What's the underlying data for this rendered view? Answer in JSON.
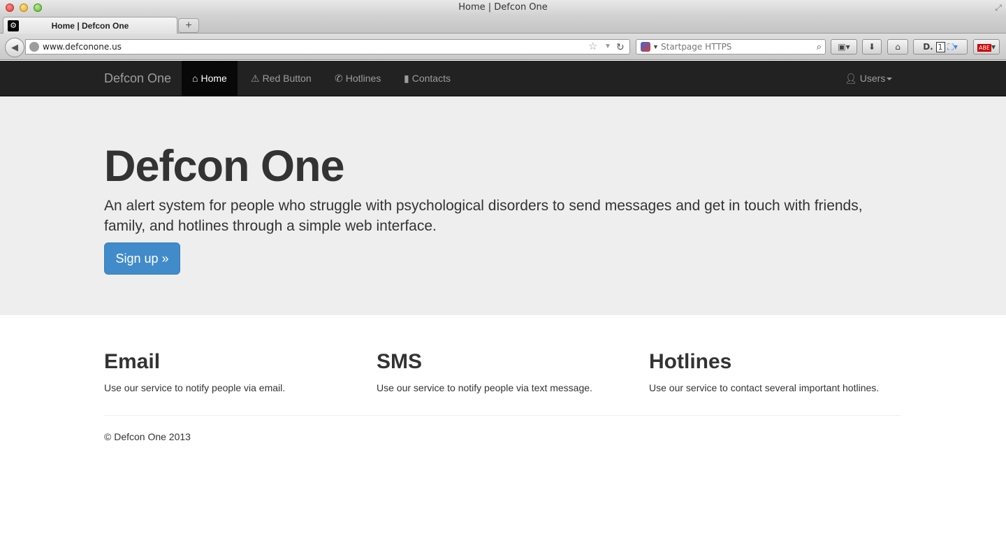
{
  "window": {
    "title": "Home | Defcon One"
  },
  "tabs": [
    {
      "label": "Home | Defcon One",
      "favicon": "gear-icon"
    }
  ],
  "toolbar": {
    "url": "www.defconone.us",
    "search_placeholder": "Startpage HTTPS",
    "icons": [
      "back-arrow-icon",
      "globe-icon",
      "bookmark-star-icon",
      "reload-icon",
      "search-icon",
      "bookmarks-icon",
      "download-icon",
      "home-icon",
      "addon-d-icon",
      "addon-counter-icon",
      "addon-abe-icon"
    ],
    "addon_counter": "1"
  },
  "site_nav": {
    "brand": "Defcon One",
    "items": [
      {
        "label": "Home",
        "icon": "home-icon",
        "active": true
      },
      {
        "label": "Red Button",
        "icon": "warning-icon",
        "active": false
      },
      {
        "label": "Hotlines",
        "icon": "phone-icon",
        "active": false
      },
      {
        "label": "Contacts",
        "icon": "book-icon",
        "active": false
      }
    ],
    "users": {
      "label": "Users",
      "icon": "user-icon"
    }
  },
  "hero": {
    "title": "Defcon One",
    "lead": "An alert system for people who struggle with psychological disorders to send messages and get in touch with friends, family, and hotlines through a simple web interface.",
    "button": "Sign up »"
  },
  "features": [
    {
      "title": "Email",
      "text": "Use our service to notify people via email."
    },
    {
      "title": "SMS",
      "text": "Use our service to notify people via text message."
    },
    {
      "title": "Hotlines",
      "text": "Use our service to contact several important hotlines."
    }
  ],
  "footer": {
    "text": "© Defcon One 2013"
  },
  "colors": {
    "nav_bg": "#222222",
    "jumbotron_bg": "#eeeeee",
    "primary": "#428bca"
  }
}
